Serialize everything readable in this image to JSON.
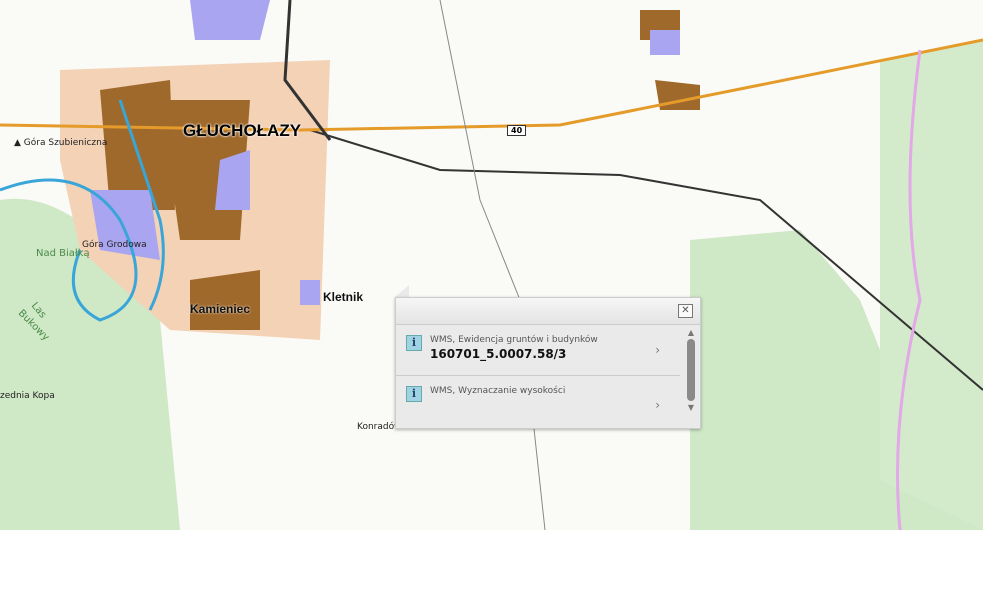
{
  "map": {
    "labels": {
      "city": "GŁUCHOŁAZY",
      "kamieniec": "Kamieniec",
      "kletnik": "Kletnik",
      "konradow": "Konradów",
      "gora_szub": "Góra Szubieniczna",
      "gora_grod": "Góra Grodowa",
      "nad_bialka": "Nad Białką",
      "las": "Las",
      "bukowy": "Bukowy",
      "srednia": "zednia Kopa",
      "road": "40"
    }
  },
  "popup": {
    "close": "✕",
    "items": [
      {
        "layer": "WMS, Ewidencja gruntów i budynków",
        "value": "160701_5.0007.58/3",
        "icon": "i",
        "chevron": "›"
      },
      {
        "layer": "WMS, Wyznaczanie wysokości",
        "value": "",
        "icon": "i",
        "chevron": "›"
      }
    ],
    "scroll_up": "▲",
    "scroll_down": "▼"
  }
}
